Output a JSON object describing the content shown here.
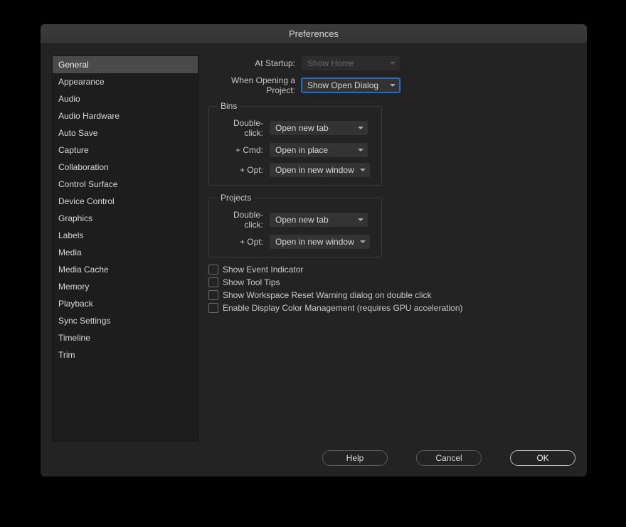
{
  "title": "Preferences",
  "sidebar": {
    "items": [
      "General",
      "Appearance",
      "Audio",
      "Audio Hardware",
      "Auto Save",
      "Capture",
      "Collaboration",
      "Control Surface",
      "Device Control",
      "Graphics",
      "Labels",
      "Media",
      "Media Cache",
      "Memory",
      "Playback",
      "Sync Settings",
      "Timeline",
      "Trim"
    ],
    "selected": 0
  },
  "top": {
    "at_startup_label": "At Startup:",
    "at_startup_value": "Show Home",
    "open_project_label": "When Opening a Project:",
    "open_project_value": "Show Open Dialog"
  },
  "bins": {
    "legend": "Bins",
    "double_click_label": "Double-click:",
    "double_click_value": "Open new tab",
    "cmd_label": "+ Cmd:",
    "cmd_value": "Open in place",
    "opt_label": "+ Opt:",
    "opt_value": "Open in new window"
  },
  "projects": {
    "legend": "Projects",
    "double_click_label": "Double-click:",
    "double_click_value": "Open new tab",
    "opt_label": "+ Opt:",
    "opt_value": "Open in new window"
  },
  "checks": {
    "event_indicator": "Show Event Indicator",
    "tool_tips": "Show Tool Tips",
    "workspace_reset": "Show Workspace Reset Warning dialog on double click",
    "color_mgmt": "Enable Display Color Management (requires GPU acceleration)"
  },
  "buttons": {
    "help": "Help",
    "cancel": "Cancel",
    "ok": "OK"
  }
}
